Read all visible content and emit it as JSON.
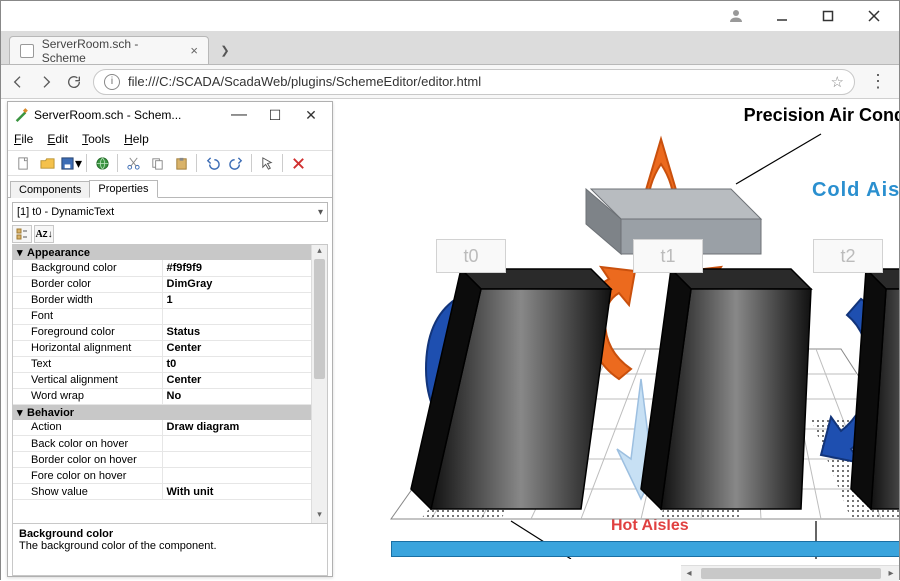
{
  "browser": {
    "tab_title": "ServerRoom.sch - Scheme",
    "url": "file:///C:/SCADA/ScadaWeb/plugins/SchemeEditor/editor.html"
  },
  "toolwin": {
    "title": "ServerRoom.sch - Schem...",
    "menus": {
      "file": "File",
      "edit": "Edit",
      "tools": "Tools",
      "help": "Help"
    },
    "tabs": {
      "components": "Components",
      "properties": "Properties"
    },
    "selector": "[1] t0 - DynamicText"
  },
  "propgrid": {
    "cat_appearance": "Appearance",
    "rows_appearance": [
      {
        "name": "Background color",
        "value": "#f9f9f9"
      },
      {
        "name": "Border color",
        "value": "DimGray"
      },
      {
        "name": "Border width",
        "value": "1"
      },
      {
        "name": "Font",
        "value": ""
      },
      {
        "name": "Foreground color",
        "value": "Status"
      },
      {
        "name": "Horizontal alignment",
        "value": "Center"
      },
      {
        "name": "Text",
        "value": "t0"
      },
      {
        "name": "Vertical alignment",
        "value": "Center"
      },
      {
        "name": "Word wrap",
        "value": "No"
      }
    ],
    "cat_behavior": "Behavior",
    "rows_behavior": [
      {
        "name": "Action",
        "value": "Draw diagram"
      },
      {
        "name": "Back color on hover",
        "value": ""
      },
      {
        "name": "Border color on hover",
        "value": ""
      },
      {
        "name": "Fore color on hover",
        "value": ""
      },
      {
        "name": "Show value",
        "value": "With unit"
      }
    ],
    "desc_title": "Background color",
    "desc_text": "The background color of the component."
  },
  "diagram": {
    "label_pac": "Precision Air Conditionin",
    "label_cold": "Cold Aisle",
    "label_hot": "Hot Aisles",
    "placeholders": [
      "t0",
      "t1",
      "t2"
    ]
  }
}
